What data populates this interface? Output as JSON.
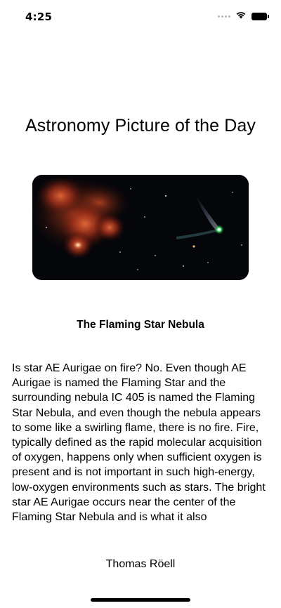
{
  "status_bar": {
    "time": "4:25",
    "icons": [
      "cellular-signal-icon",
      "wifi-icon",
      "battery-icon"
    ]
  },
  "page": {
    "title": "Astronomy Picture of the Day"
  },
  "picture": {
    "title": "The Flaming Star Nebula",
    "image_description_icon": "nebula-and-comet-photo",
    "explanation": "Is star AE Aurigae on fire? No.  Even though AE Aurigae is named the Flaming Star and the surrounding nebula IC 405 is named the Flaming Star Nebula, and even though the nebula appears to some like a swirling flame, there is no fire.  Fire, typically defined as the rapid molecular acquisition of oxygen, happens only when sufficient oxygen is present and is not important in such high-energy, low-oxygen environments such as stars.  The bright star AE Aurigae occurs near the center of the Flaming Star Nebula and is what it also",
    "copyright": "Thomas Röell"
  },
  "colors": {
    "background": "#ffffff",
    "text": "#000000",
    "nebula_red": "#c4421c",
    "comet_green": "#4dff7a"
  }
}
